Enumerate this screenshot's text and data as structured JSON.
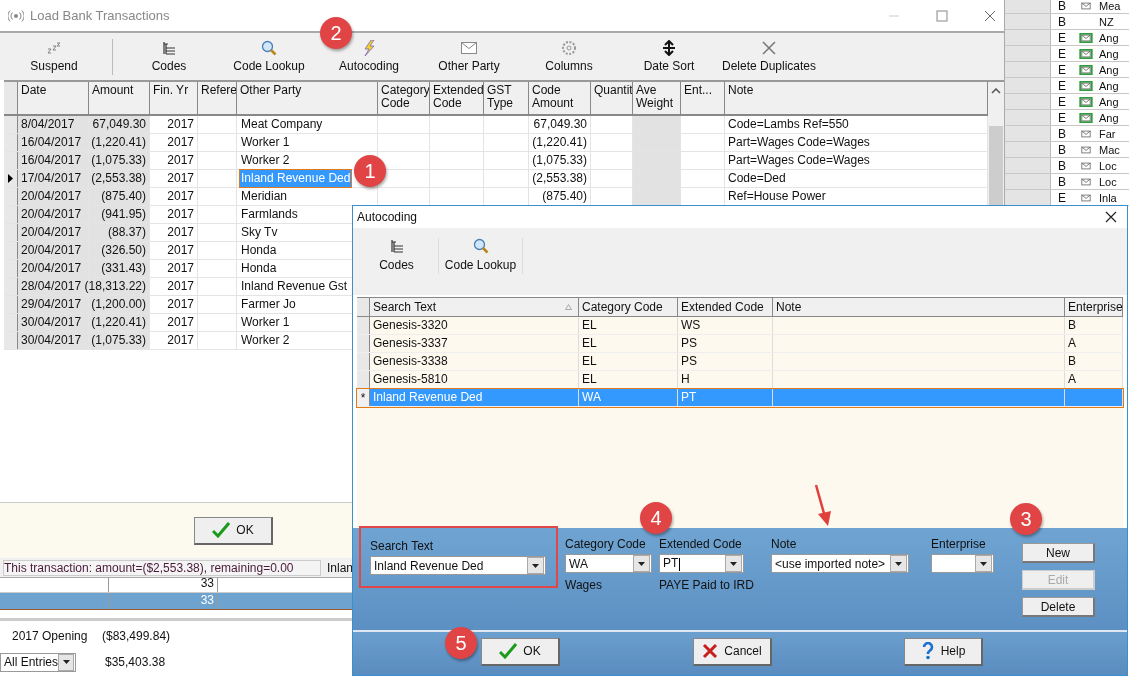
{
  "background_app": {
    "side_rows": [
      {
        "enterprise": "B",
        "envelope": true,
        "marked": false,
        "text": "Mea"
      },
      {
        "enterprise": "B",
        "envelope": false,
        "marked": false,
        "text": "NZ"
      },
      {
        "enterprise": "E",
        "envelope": true,
        "marked": true,
        "text": "Ang"
      },
      {
        "enterprise": "E",
        "envelope": true,
        "marked": true,
        "text": "Ang"
      },
      {
        "enterprise": "E",
        "envelope": true,
        "marked": true,
        "text": "Ang"
      },
      {
        "enterprise": "E",
        "envelope": true,
        "marked": true,
        "text": "Ang"
      },
      {
        "enterprise": "E",
        "envelope": true,
        "marked": true,
        "text": "Ang"
      },
      {
        "enterprise": "E",
        "envelope": true,
        "marked": true,
        "text": "Ang"
      },
      {
        "enterprise": "B",
        "envelope": true,
        "marked": false,
        "text": "Far"
      },
      {
        "enterprise": "B",
        "envelope": true,
        "marked": false,
        "text": "Mac"
      },
      {
        "enterprise": "B",
        "envelope": true,
        "marked": false,
        "text": "Loc"
      },
      {
        "enterprise": "B",
        "envelope": true,
        "marked": false,
        "text": "Loc"
      },
      {
        "enterprise": "E",
        "envelope": true,
        "marked": false,
        "text": "Inla"
      }
    ],
    "bottom_rows": [
      {
        "count": "33",
        "selected": false
      },
      {
        "count": "33",
        "selected": true
      }
    ],
    "opening_label": "2017 Opening",
    "opening_amount": "($83,499.84)",
    "filter": "All Entries",
    "balance": "$35,403.38"
  },
  "load_window": {
    "title": "Load Bank Transactions",
    "toolbar": [
      "Suspend",
      "Codes",
      "Code Lookup",
      "Autocoding",
      "Other Party",
      "Columns",
      "Date Sort",
      "Delete  Duplicates"
    ],
    "columns": [
      "Date",
      "Amount",
      "Fin. Yr",
      "Refere",
      "Other Party",
      "Category Code",
      "Extended Code",
      "GST Type",
      "Code Amount",
      "Quantit",
      "Ave Weight",
      "Ent...",
      "Note"
    ],
    "rows": [
      {
        "date": "8/04/2017",
        "amount": "67,049.30",
        "fin_yr": "2017",
        "other_party": "Meat Company",
        "code_amount": "67,049.30",
        "note": "Code=Lambs Ref=550",
        "selected": false
      },
      {
        "date": "16/04/2017",
        "amount": "(1,220.41)",
        "fin_yr": "2017",
        "other_party": "Worker 1",
        "code_amount": "(1,220.41)",
        "note": "Part=Wages Code=Wages",
        "selected": false
      },
      {
        "date": "16/04/2017",
        "amount": "(1,075.33)",
        "fin_yr": "2017",
        "other_party": "Worker 2",
        "code_amount": "(1,075.33)",
        "note": "Part=Wages Code=Wages",
        "selected": false
      },
      {
        "date": "17/04/2017",
        "amount": "(2,553.38)",
        "fin_yr": "2017",
        "other_party": "Inland Revenue Ded",
        "code_amount": "(2,553.38)",
        "note": "Code=Ded",
        "selected": true
      },
      {
        "date": "20/04/2017",
        "amount": "(875.40)",
        "fin_yr": "2017",
        "other_party": "Meridian",
        "code_amount": "(875.40)",
        "note": "Ref=House Power",
        "selected": false
      },
      {
        "date": "20/04/2017",
        "amount": "(941.95)",
        "fin_yr": "2017",
        "other_party": "Farmlands",
        "selected": false
      },
      {
        "date": "20/04/2017",
        "amount": "(88.37)",
        "fin_yr": "2017",
        "other_party": "Sky Tv",
        "selected": false
      },
      {
        "date": "20/04/2017",
        "amount": "(326.50)",
        "fin_yr": "2017",
        "other_party": "Honda",
        "selected": false
      },
      {
        "date": "20/04/2017",
        "amount": "(331.43)",
        "fin_yr": "2017",
        "other_party": "Honda",
        "selected": false
      },
      {
        "date": "28/04/2017",
        "amount": "(18,313.22)",
        "fin_yr": "2017",
        "other_party": "Inland Revenue Gst",
        "selected": false
      },
      {
        "date": "29/04/2017",
        "amount": "(1,200.00)",
        "fin_yr": "2017",
        "other_party": "Farmer Jo",
        "selected": false
      },
      {
        "date": "30/04/2017",
        "amount": "(1,220.41)",
        "fin_yr": "2017",
        "other_party": "Worker 1",
        "selected": false
      },
      {
        "date": "30/04/2017",
        "amount": "(1,075.33)",
        "fin_yr": "2017",
        "other_party": "Worker 2",
        "selected": false
      }
    ],
    "ok_button": "OK",
    "status_text": "This transaction: amount=($2,553.38), remaining=0.00",
    "status_party": "Inlan"
  },
  "autocoding": {
    "title": "Autocoding",
    "toolbar": [
      "Codes",
      "Code Lookup"
    ],
    "columns": [
      "Search Text",
      "Category Code",
      "Extended Code",
      "Note",
      "Enterprise"
    ],
    "rows": [
      {
        "search_text": "Genesis-3320",
        "category_code": "EL",
        "extended_code": "WS",
        "enterprise": "B",
        "selected": false
      },
      {
        "search_text": "Genesis-3337",
        "category_code": "EL",
        "extended_code": "PS",
        "enterprise": "A",
        "selected": false
      },
      {
        "search_text": "Genesis-3338",
        "category_code": "EL",
        "extended_code": "PS",
        "enterprise": "B",
        "selected": false
      },
      {
        "search_text": "Genesis-5810",
        "category_code": "EL",
        "extended_code": "H",
        "enterprise": "A",
        "selected": false
      },
      {
        "marker": "*",
        "search_text": "Inland Revenue Ded",
        "category_code": "WA",
        "extended_code": "PT",
        "selected": true
      }
    ],
    "search_text": {
      "label": "Search Text",
      "value": "Inland Revenue Ded"
    },
    "category_code": {
      "label": "Category Code",
      "value": "WA",
      "description": "Wages"
    },
    "extended_code": {
      "label": "Extended Code",
      "value": "PT",
      "description": "PAYE Paid to IRD",
      "focused": true
    },
    "note": {
      "label": "Note",
      "value": "<use imported note>"
    },
    "enterprise": {
      "label": "Enterprise"
    },
    "side_buttons": [
      {
        "label": "New",
        "disabled": false
      },
      {
        "label": "Edit",
        "disabled": true
      },
      {
        "label": "Delete",
        "disabled": false
      }
    ],
    "ok_button": "OK",
    "cancel_button": "Cancel",
    "help_button": "Help"
  },
  "callouts": [
    "1",
    "2",
    "3",
    "4",
    "5"
  ]
}
